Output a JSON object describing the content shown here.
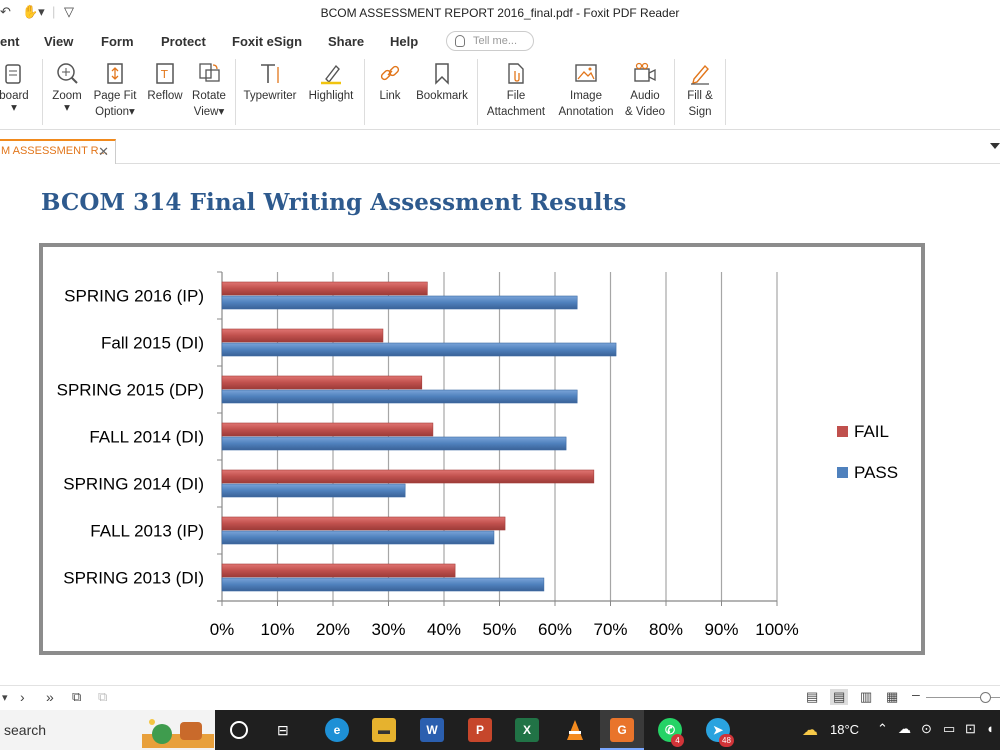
{
  "window": {
    "title": "BCOM ASSESSMENT REPORT 2016_final.pdf - Foxit PDF Reader"
  },
  "menu": [
    {
      "id": "comment",
      "label": "ent"
    },
    {
      "id": "view",
      "label": "View"
    },
    {
      "id": "form",
      "label": "Form"
    },
    {
      "id": "protect",
      "label": "Protect"
    },
    {
      "id": "foxit-esign",
      "label": "Foxit eSign"
    },
    {
      "id": "share",
      "label": "Share"
    },
    {
      "id": "help",
      "label": "Help"
    }
  ],
  "tell_me": {
    "placeholder": "Tell me..."
  },
  "ribbon": {
    "clipboard": "board",
    "zoom": "Zoom",
    "page_fit_1": "Page Fit",
    "page_fit_2": "Option",
    "reflow": "Reflow",
    "rotate_1": "Rotate",
    "rotate_2": "View",
    "typewriter": "Typewriter",
    "highlight": "Highlight",
    "link": "Link",
    "bookmark": "Bookmark",
    "file_attach_1": "File",
    "file_attach_2": "Attachment",
    "image_annot_1": "Image",
    "image_annot_2": "Annotation",
    "audio_video_1": "Audio",
    "audio_video_2": "& Video",
    "fill_sign_1": "Fill &",
    "fill_sign_2": "Sign"
  },
  "tab": {
    "label": "M ASSESSMENT R..."
  },
  "document": {
    "heading": "BCOM 314 Final Writing Assessment Results"
  },
  "chart_data": {
    "type": "bar",
    "orientation": "horizontal",
    "categories": [
      "SPRING 2016 (IP)",
      "Fall 2015 (DI)",
      "SPRING 2015 (DP)",
      "FALL 2014 (DI)",
      "SPRING 2014 (DI)",
      "FALL 2013 (IP)",
      "SPRING 2013 (DI)"
    ],
    "series": [
      {
        "name": "FAIL",
        "color": "#c0504d",
        "values": [
          37,
          29,
          36,
          38,
          67,
          51,
          42
        ]
      },
      {
        "name": "PASS",
        "color": "#4f81bd",
        "values": [
          64,
          71,
          64,
          62,
          33,
          49,
          58
        ]
      }
    ],
    "xlim": [
      0,
      100
    ],
    "x_ticks": [
      "0%",
      "10%",
      "20%",
      "30%",
      "40%",
      "50%",
      "60%",
      "70%",
      "80%",
      "90%",
      "100%"
    ],
    "grid": true,
    "legend": "right"
  },
  "taskbar": {
    "search": "search",
    "temperature": "18°C",
    "whatsapp_badge": "4",
    "telegram_badge": "48"
  }
}
